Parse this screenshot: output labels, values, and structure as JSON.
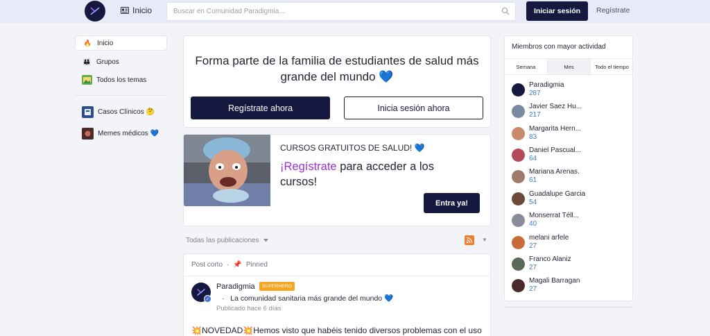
{
  "header": {
    "home_label": "Inicio",
    "search_placeholder": "Buscar en Comunidad Paradigmia...",
    "login_label": "Iniciar sesión",
    "register_label": "Regístrate"
  },
  "left_nav": {
    "items": [
      {
        "label": "Inicio",
        "icon": "fire-icon"
      },
      {
        "label": "Grupos",
        "icon": "group-icon"
      },
      {
        "label": "Todos los temas",
        "icon": "picture-icon"
      }
    ],
    "spaces": [
      {
        "label": "Casos Clínicos 🤔",
        "icon": "clinical-cases-icon"
      },
      {
        "label": "Memes médicos 💙",
        "icon": "memes-icon"
      }
    ]
  },
  "hero": {
    "title": "Forma parte de la familia de estudiantes de salud más grande del mundo 💙",
    "register_button": "Regístrate ahora",
    "login_button": "Inicia sesión ahora"
  },
  "promo": {
    "tag": "CURSOS GRATUITOS DE SALUD! 💙",
    "accent": "¡Regístrate",
    "text_rest": " para acceder a los cursos!",
    "button": "Entra ya!"
  },
  "feed": {
    "filter_label": "Todas las publicaciones"
  },
  "post": {
    "type_label": "Post corto",
    "pinned_label": "Pinned",
    "author": "Paradigmia",
    "badge": "SUPERHERO",
    "community": "La comunidad sanitaria más grande del mundo 💙",
    "published": "Publicado hace 6 días",
    "body": "💥NOVEDAD💥Hemos visto que habéis tenido diversos problemas con el uso"
  },
  "leaderboard": {
    "title": "Miembros con mayor actividad",
    "tabs": [
      "Semana",
      "Mes",
      "Todo el tiempo"
    ],
    "active_tab": "Mes",
    "members": [
      {
        "name": "Paradigmia",
        "points": "287",
        "color": "#15183f"
      },
      {
        "name": "Javier Saez Hu...",
        "points": "217",
        "color": "#7a8aa0"
      },
      {
        "name": "Margarita Hern...",
        "points": "83",
        "color": "#c98a6b"
      },
      {
        "name": "Daniel Pascual...",
        "points": "64",
        "color": "#b24a5a"
      },
      {
        "name": "Mariana Arenas.",
        "points": "61",
        "color": "#9c7b6a"
      },
      {
        "name": "Guadalupe Garcia",
        "points": "54",
        "color": "#6b4a3a"
      },
      {
        "name": "Monserrat Téll...",
        "points": "40",
        "color": "#8a8d99"
      },
      {
        "name": "melani arfele",
        "points": "27",
        "color": "#c86b3a"
      },
      {
        "name": "Franco Alaniz",
        "points": "27",
        "color": "#5a6a5a"
      },
      {
        "name": "Magali Barragan",
        "points": "27",
        "color": "#4a2a2a"
      }
    ]
  }
}
